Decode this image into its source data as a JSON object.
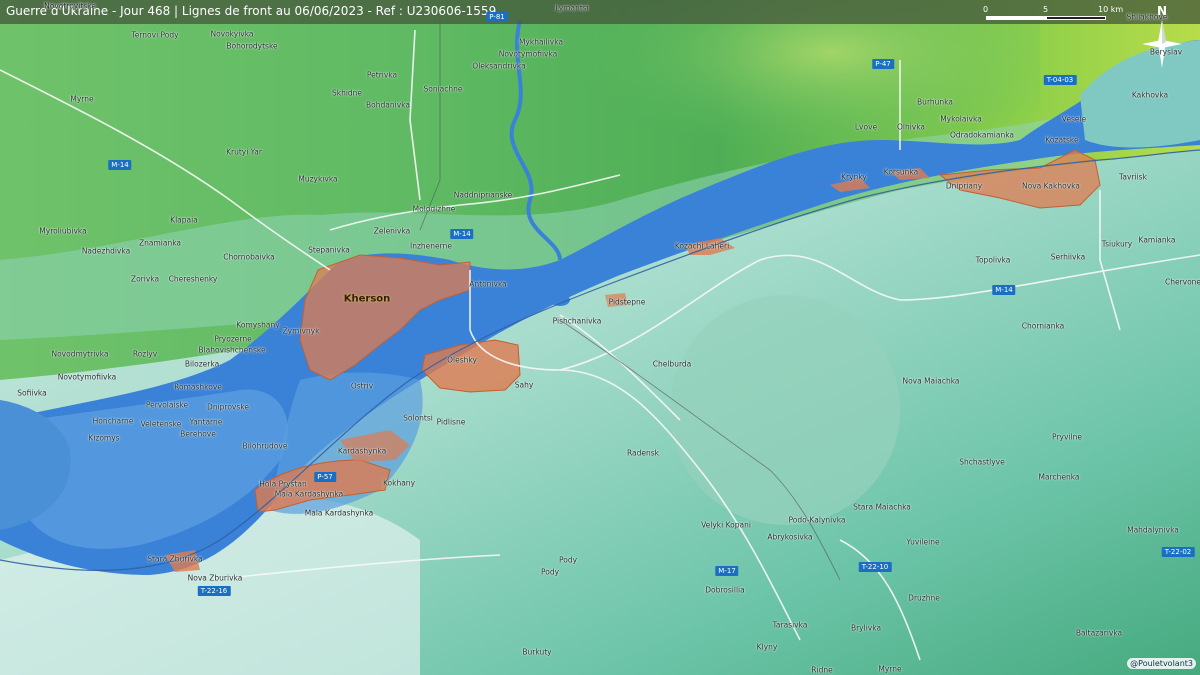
{
  "header": {
    "title": "Guerre d'Ukraine - Jour 468 | Lignes de front au 06/06/2023 - Ref : U230606-1559"
  },
  "scale_bar": {
    "labels": [
      "0",
      "5",
      "10 km"
    ]
  },
  "north_arrow": {
    "label": "N"
  },
  "credit": "@Pouletvolant3",
  "colors": {
    "river": "#3a82d8",
    "occupied_zone": "#e07b50",
    "lowland": "#8fd3c2",
    "highland": "#58b85a"
  },
  "cities": {
    "kherson": "Kherson"
  },
  "roads": {
    "p81": "P-81",
    "p47": "P-47",
    "t0403": "T-04-03",
    "m14_west": "M-14",
    "m14_center": "M-14",
    "m14_east": "M-14",
    "p57": "P-57",
    "m17": "M-17",
    "t2216": "T-22-16",
    "t2210": "T-22-10",
    "t2202": "T-22-02"
  },
  "places": {
    "novotroyitske": "Novotroyitske",
    "ternovi_pody": "Ternovi Pody",
    "novokyivka": "Novokyivka",
    "bohorodytske": "Bohorodytske",
    "lymantsi": "Lymantsi",
    "mykhailivka": "Mykhailivka",
    "novotymofiivka": "Novotymofiivka",
    "oleksandrivka": "Oleksandrivka",
    "petrivka": "Petrivka",
    "skhidne": "Skhidne",
    "bohdanivka": "Bohdanivka",
    "soniachne": "Soniachne",
    "myrne_nw": "Myrne",
    "krutyi_yar": "Krutyi Yar",
    "muzykivka": "Muzykivka",
    "klapaia": "Klapaia",
    "myroliubivka": "Myroliubivka",
    "nadezhdivka": "Nadezhdivka",
    "znamianka": "Znamianka",
    "chornobaivka": "Chornobaivka",
    "stepanivka": "Stepanivka",
    "zelenivka": "Zelenivka",
    "molodizhne": "Molodizhne",
    "naddniprianske": "Naddniprianske",
    "inzhenerne": "Inzhenerne",
    "antonivka": "Antonivka",
    "zorivka": "Zorivka",
    "chereshenky": "Chereshenky",
    "komyshany": "Komyshany",
    "zymivnyk": "Zymivnyk",
    "pryozerne": "Pryozerne",
    "blahovishchenske": "Blahovishchenske",
    "novodmytrivka": "Novodmytrivka",
    "rozlyv": "Rozlyv",
    "bilozerka": "Bilozerka",
    "novotymofiivka_w": "Novotymofiivka",
    "romashkove": "Romashkove",
    "sofiivka": "Sofiivka",
    "pervolaiske": "Pervolaiske",
    "dniprovske": "Dniprovske",
    "honcharne": "Honcharne",
    "veletenske": "Veletenske",
    "yantarne": "Yantarne",
    "kizomys": "Kizomys",
    "berehove": "Berehove",
    "bilohrudove": "Bilohrudove",
    "ostriv": "Ostriv",
    "oleshky": "Oleshky",
    "sahy": "Sahy",
    "solontsi": "Solontsi",
    "pidlisne": "Pidlisne",
    "kardashynka": "Kardashynka",
    "hola_prystan": "Hola Prystan",
    "mala_kardashynka": "Mala Kardashynka",
    "mala_kardashynka_2": "Mala Kardashynka",
    "kokhany": "Kokhany",
    "stara_zburivka": "Stara Zburivka",
    "nova_zburivka": "Nova Zburivka",
    "pishchanivka": "Pishchanivka",
    "pidstepne": "Pidstepne",
    "chelburda": "Chelburda",
    "kozachi_laheri": "Kozachi Laheri",
    "krynky": "Krynky",
    "korsunka": "Korsunka",
    "dnipriany": "Dnipriany",
    "nova_kakhovka": "Nova Kakhovka",
    "lvove": "Lvove",
    "olhivka": "Olhivka",
    "burhunka": "Burhunka",
    "mykolaivka": "Mykolaivka",
    "odradokamianka": "Odradokamianka",
    "kozatske": "Kozatske",
    "vesele": "Vesele",
    "beryslav": "Beryslav",
    "shliakhove": "Shliakhove",
    "kakhovka": "Kakhovka",
    "tavriisk": "Tavriisk",
    "tsiukury": "Tsiukury",
    "kamianka": "Kamianka",
    "serhiivka": "Serhiivka",
    "topolivka": "Topolivka",
    "chervone": "Chervone",
    "chornianka": "Chornianka",
    "nova_maiachka": "Nova Maiachka",
    "pryvilne": "Pryvilne",
    "shchastlyve": "Shchastlyve",
    "marchenka": "Marchenka",
    "radensk": "Radensk",
    "velyki_kopani": "Velyki Kopani",
    "podo_kalynivka": "Podo-Kalynivka",
    "abrykosivka": "Abrykosivka",
    "stara_maiachka": "Stara Maiachka",
    "yuvileine": "Yuvileine",
    "mahdalynivka": "Mahdalynivka",
    "pody_1": "Pody",
    "pody_2": "Pody",
    "dobrosillia": "Dobrosillia",
    "druzhne": "Druzhne",
    "tarasivka": "Tarasivka",
    "brylivka": "Brylivka",
    "baltazarivka": "Baltazarivka",
    "burkuty": "Burkuty",
    "klyny": "Klyny",
    "ridne": "Ridne",
    "myrne_s": "Myrne"
  }
}
